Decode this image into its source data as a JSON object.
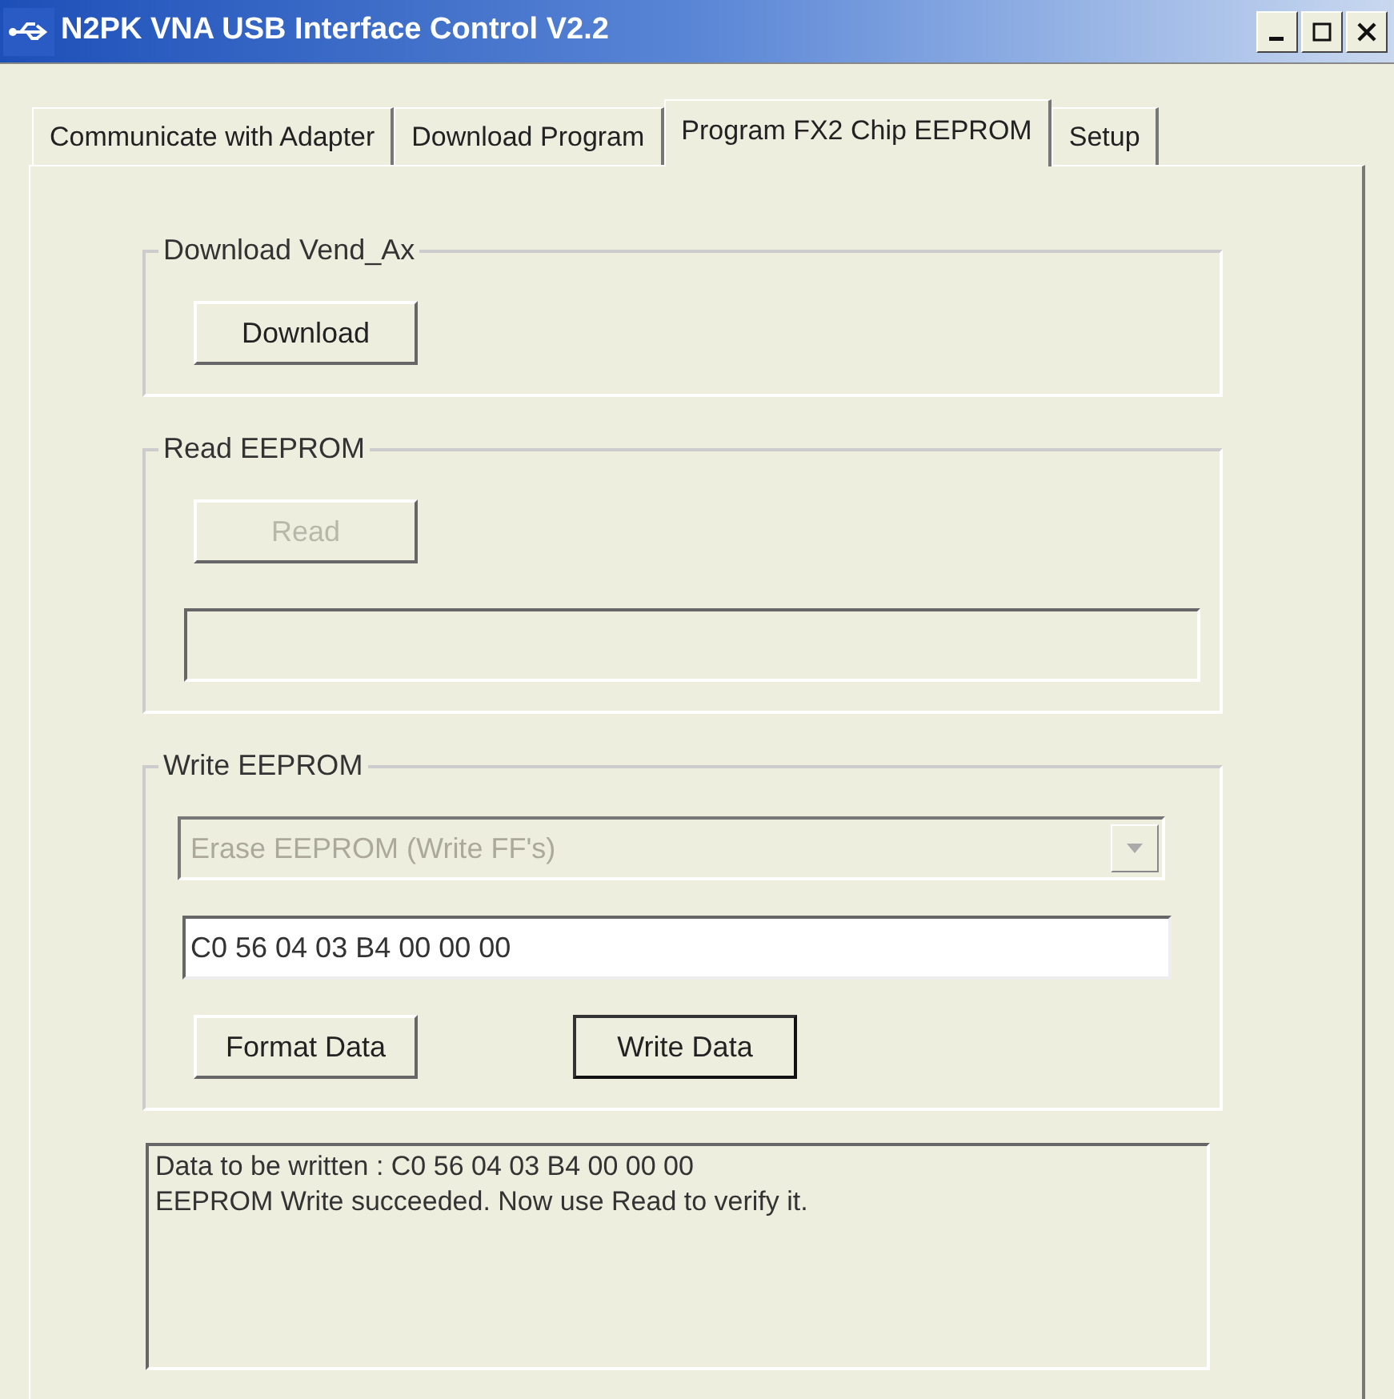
{
  "window": {
    "title": "N2PK VNA USB Interface Control V2.2"
  },
  "tabs": [
    {
      "label": "Communicate with Adapter",
      "selected": false
    },
    {
      "label": "Download Program",
      "selected": false
    },
    {
      "label": "Program FX2 Chip EEPROM",
      "selected": true
    },
    {
      "label": "Setup",
      "selected": false
    }
  ],
  "groups": [
    {
      "title": "Download Vend_Ax",
      "items": [
        {
          "kind": "buttons",
          "buttons": [
            {
              "label": "Download",
              "disabled": false,
              "focused": false
            }
          ]
        }
      ]
    },
    {
      "title": "Read EEPROM",
      "items": [
        {
          "kind": "buttons",
          "buttons": [
            {
              "label": "Read",
              "disabled": true,
              "focused": false
            }
          ]
        },
        {
          "kind": "output"
        }
      ]
    },
    {
      "title": "Write EEPROM",
      "items": [
        {
          "kind": "dropdown",
          "value": "Erase EEPROM (Write FF's)",
          "disabled": true
        },
        {
          "kind": "field",
          "value": "C0 56 04 03 B4 00 00 00"
        },
        {
          "kind": "buttons",
          "buttons": [
            {
              "label": "Format Data",
              "disabled": false,
              "focused": false
            },
            {
              "label": "Write Data",
              "disabled": false,
              "focused": true
            }
          ]
        }
      ]
    }
  ],
  "log": {
    "lines": [
      "Data to be written : C0 56 04 03 B4 00 00 00",
      "EEPROM Write succeeded. Now use Read to verify it."
    ]
  }
}
